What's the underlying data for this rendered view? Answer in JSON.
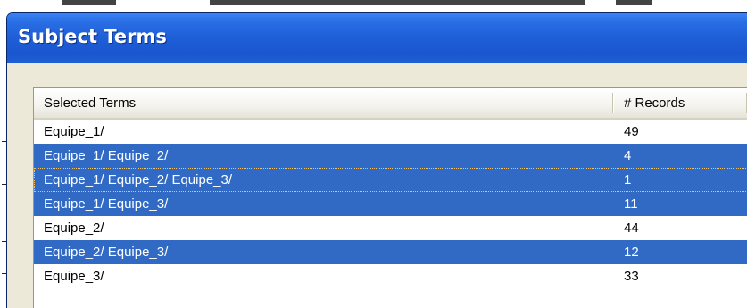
{
  "window": {
    "title": "Subject Terms"
  },
  "list": {
    "columns": [
      "Selected Terms",
      "# Records"
    ],
    "rows": [
      {
        "term": "Equipe_1/",
        "records": "49",
        "selected": false
      },
      {
        "term": "Equipe_1/ Equipe_2/",
        "records": "4",
        "selected": true
      },
      {
        "term": "Equipe_1/ Equipe_2/ Equipe_3/",
        "records": "1",
        "selected": true
      },
      {
        "term": "Equipe_1/ Equipe_3/",
        "records": "11",
        "selected": true
      },
      {
        "term": "Equipe_2/",
        "records": "44",
        "selected": false
      },
      {
        "term": "Equipe_2/ Equipe_3/",
        "records": "12",
        "selected": true
      },
      {
        "term": "Equipe_3/",
        "records": "33",
        "selected": false
      }
    ]
  },
  "colors": {
    "title_bar": "#1e5ed6",
    "selection": "#316ac5",
    "dialog_face": "#ece9d8"
  }
}
